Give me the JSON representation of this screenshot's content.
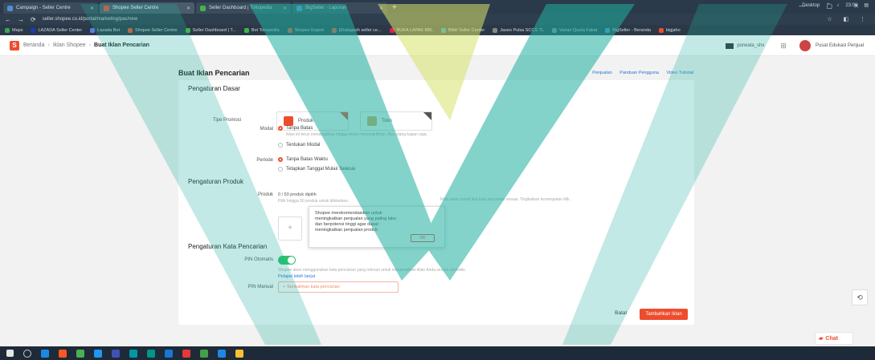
{
  "browser": {
    "tabs": [
      {
        "label": "Campaign - Seller Centre",
        "color": "#4f8fd6",
        "active": false
      },
      {
        "label": "Shopee Seller Centre",
        "color": "#ee4d2d",
        "active": true
      },
      {
        "label": "Seller Dashboard | Tokopedia",
        "color": "#42b549",
        "active": false
      },
      {
        "label": "BigSeller - Laporan",
        "color": "#4f8fd6",
        "active": false
      }
    ],
    "new_tab": "+",
    "url": "seller.shopee.co.id/portal/marketing/pas/new",
    "bookmarks": [
      {
        "label": "Maps",
        "color": "#3aa757"
      },
      {
        "label": "LAZADA Seller Center",
        "color": "#1a3cb6"
      },
      {
        "label": "Lazada Bot",
        "color": "#5b7de0"
      },
      {
        "label": "Shopee Seller Centre",
        "color": "#ee4d2d"
      },
      {
        "label": "Seller Dashboard | T...",
        "color": "#42b549"
      },
      {
        "label": "Bot Tokopedia",
        "color": "#42b549"
      },
      {
        "label": "Shopee Export",
        "color": "#ee4d2d"
      },
      {
        "label": "[Etalagazh seller ce...",
        "color": "#ee4d2d"
      },
      {
        "label": "BUKA LAPAK BBL",
        "color": "#e31e52"
      },
      {
        "label": "Blibli Seller Center",
        "color": "#0095da"
      },
      {
        "label": "Jaseo Pulsa SCCS TL",
        "color": "#888888"
      },
      {
        "label": "Varian Quota Fakat",
        "color": "#888888"
      },
      {
        "label": "BigSeller - Beranda",
        "color": "#4f8fd6"
      },
      {
        "label": "bigjaho",
        "color": "#ee4d2d"
      }
    ]
  },
  "header": {
    "breadcrumb": [
      "Beranda",
      "Iklan Shopee",
      "Buat Iklan Pencarian"
    ],
    "shop_name": "porwata_shx",
    "edu_label": "Pusat Edukasi Penjual"
  },
  "page": {
    "title": "Buat Iklan Pencarian",
    "top_links": [
      "Penjualan",
      "Panduan Pengguna",
      "Video Tutorial"
    ],
    "sections": {
      "basic": "Pengaturan Dasar",
      "product": "Pengaturan Produk",
      "keyword": "Pengaturan Kata Pencarian"
    },
    "labels": {
      "promo_type": "Tipe Promosi",
      "budget": "Modal",
      "period": "Periode",
      "product": "Produk",
      "auto": "PIN Otomatis",
      "keywords": "PIN Manual"
    },
    "promo_options": [
      "Produk",
      "Toko"
    ],
    "budget_options": [
      "Tanpa Batas",
      "Tentukan Modal"
    ],
    "budget_hint": "Iklan ini terus menampilkan hingga Anda menonaktifkan. Atur ulang kapan saja.",
    "period_options": [
      "Tanpa Batas Waktu",
      "Tetapkan Tanggal Mulai/ Selesai"
    ],
    "product_count": "0 / 50 produk dipilih",
    "product_hint": "Pilih hingga 50 produk untuk diiklankan.",
    "product_note": "Iklan akan tampil jika kata pencarian sesuai. Tingkatkan kesempatan klik.",
    "auto_hint": "Shopee akan menggunakan kata pencarian yang relevan untuk menampilkan iklan Anda secara otomatis.",
    "auto_link": "Pelajari lebih lanjut",
    "keyword_placeholder": "+ Tambahkan kata pencarian",
    "cancel": "Batal",
    "save": "Tambahkan Iklan"
  },
  "popup": {
    "message": "Shopee merekomendasikan untuk meningkatkan penjualan yang paling laku dan berpotensi tinggi agar dapat meningkatkan penjualan produk",
    "ok": "OK"
  },
  "chat_label": "Chat",
  "taskbar": {
    "desktop_label": "Desktop",
    "time": "23:06",
    "icons": [
      "#1e88e5",
      "#ff5722",
      "#4caf50",
      "#2196f3",
      "#3f51b5",
      "#0097a7",
      "#009688",
      "#1976d2",
      "#e53935",
      "#43a047",
      "#1e88e5",
      "#fbc02d"
    ]
  },
  "colors": {
    "brand": "#ee4d2d",
    "link": "#2673dd",
    "toggle_on": "#2cc36b"
  }
}
